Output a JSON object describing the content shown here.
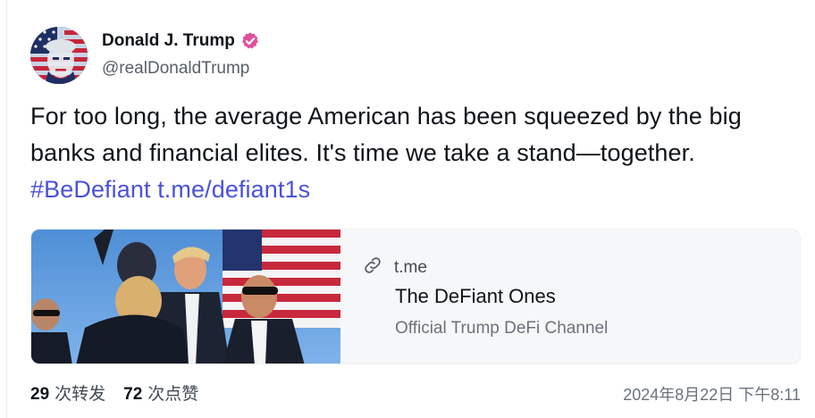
{
  "author": {
    "name": "Donald J. Trump",
    "handle": "@realDonaldTrump",
    "verified": true,
    "badge_color": "#e0529c"
  },
  "post": {
    "line1": "For too long, the average American has been squeezed by the big",
    "line2": "banks and financial elites. It's time we take a stand—together.",
    "hashtag": "#BeDefiant",
    "link_text": "t.me/defiant1s",
    "link_color": "#4a52d8"
  },
  "preview": {
    "domain": "t.me",
    "title": "The DeFiant Ones",
    "description": "Official Trump DeFi Channel",
    "image": "photo-rally-flag"
  },
  "stats": {
    "reposts_count": "29",
    "reposts_label": "次转发",
    "likes_count": "72",
    "likes_label": "次点赞"
  },
  "timestamp": "2024年8月22日 下午8:11"
}
